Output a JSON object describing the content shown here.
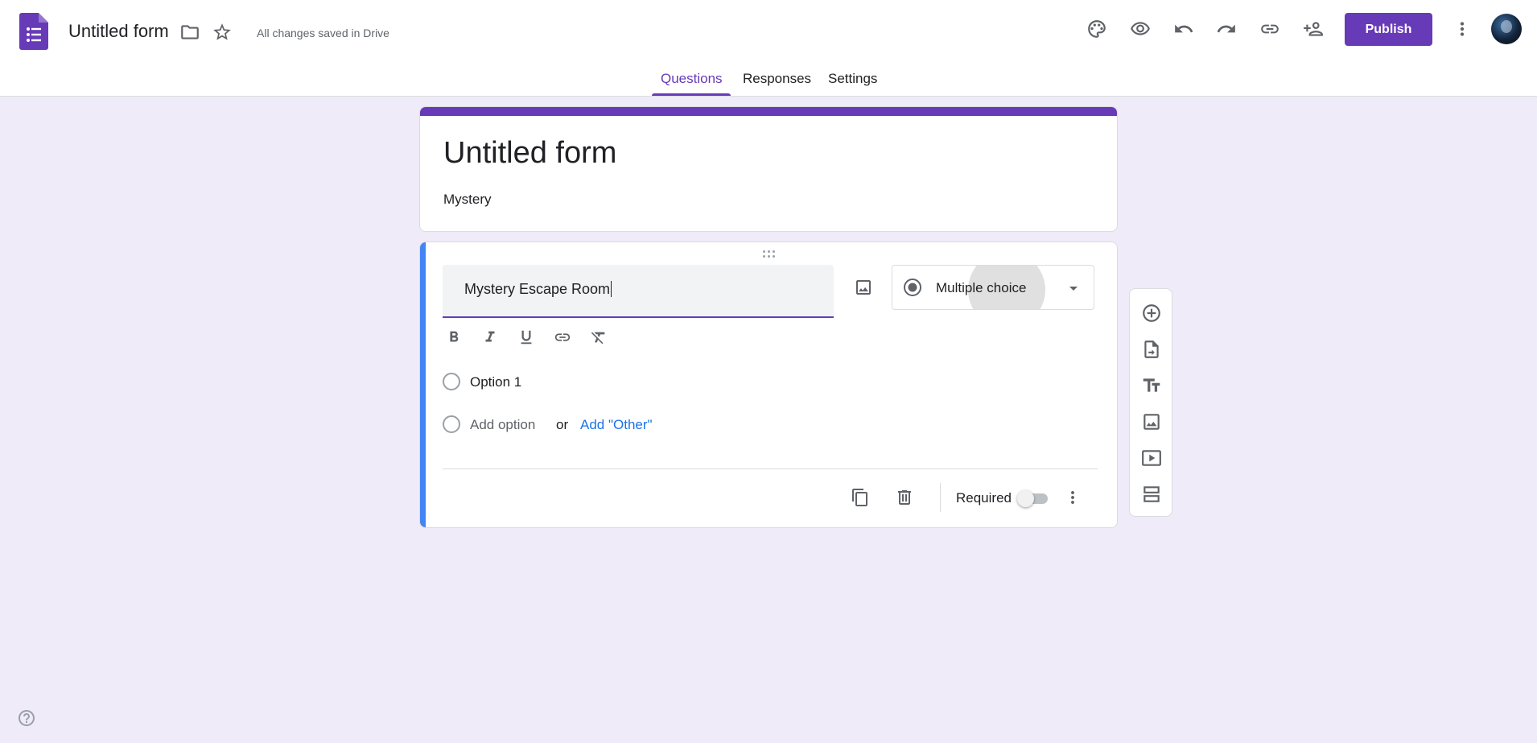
{
  "header": {
    "doc_title": "Untitled form",
    "save_status": "All changes saved in Drive",
    "publish_label": "Publish",
    "icons": [
      "forms-logo",
      "folder-icon",
      "star-icon",
      "palette-icon",
      "preview-eye-icon",
      "undo-icon",
      "redo-icon",
      "link-icon",
      "add-collaborator-icon",
      "more-vert-icon",
      "avatar"
    ]
  },
  "tabs": [
    {
      "label": "Questions",
      "active": true
    },
    {
      "label": "Responses",
      "active": false
    },
    {
      "label": "Settings",
      "active": false
    }
  ],
  "form": {
    "title": "Untitled form",
    "description": "Mystery"
  },
  "question": {
    "title_value": "Mystery Escape Room",
    "type_label": "Multiple choice",
    "options": [
      {
        "label": "Option 1"
      }
    ],
    "add_option": "Add option",
    "or_text": "or",
    "add_other": "Add \"Other\"",
    "required_label": "Required",
    "required": false
  },
  "colors": {
    "brand": "#673ab7",
    "background": "#f0ebf8",
    "active_bar": "#4285f4",
    "link": "#1a73e8"
  }
}
